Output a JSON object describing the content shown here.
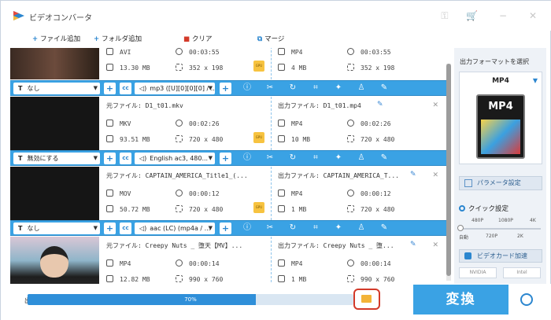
{
  "app": {
    "title": "ビデオコンバータ"
  },
  "toolbar": {
    "add_file": "ファイル追加",
    "add_folder": "フォルダ追加",
    "clear": "クリア",
    "merge": "マージ"
  },
  "rows": [
    {
      "source_name": "",
      "output_name": "",
      "src": {
        "format": "AVI",
        "duration": "00:03:55",
        "size": "13.30 MB",
        "resolution": "352 x 198"
      },
      "out": {
        "format": "MP4",
        "duration": "00:03:55",
        "size": "4 MB",
        "resolution": "352 x 198"
      },
      "subtitle": "なし",
      "audio": "mp3 ([U][0][0][0] / ..."
    },
    {
      "source_name": "元ファイル: D1_t01.mkv",
      "output_name": "出力ファイル: D1_t01.mp4",
      "src": {
        "format": "MKV",
        "duration": "00:02:26",
        "size": "93.51 MB",
        "resolution": "720 x 480"
      },
      "out": {
        "format": "MP4",
        "duration": "00:02:26",
        "size": "10 MB",
        "resolution": "720 x 480"
      },
      "subtitle": "無効にする",
      "audio": "English ac3, 480..."
    },
    {
      "source_name": "元ファイル: CAPTAIN_AMERICA_Title1_(...",
      "output_name": "出力ファイル: CAPTAIN_AMERICA_T...",
      "src": {
        "format": "MOV",
        "duration": "00:00:12",
        "size": "50.72 MB",
        "resolution": "720 x 480"
      },
      "out": {
        "format": "MP4",
        "duration": "00:00:12",
        "size": "1 MB",
        "resolution": "720 x 480"
      },
      "subtitle": "なし",
      "audio": "aac (LC) (mp4a / ..."
    },
    {
      "source_name": "元ファイル: Creepy Nuts _ 堕天【MV】...",
      "output_name": "出力ファイル: Creepy Nuts _ 堕...",
      "src": {
        "format": "MP4",
        "duration": "00:00:14",
        "size": "12.82 MB",
        "resolution": "990 x 760"
      },
      "out": {
        "format": "MP4",
        "duration": "00:00:14",
        "size": "1 MB",
        "resolution": "990 x 760"
      }
    }
  ],
  "panel": {
    "title": "出力フォーマットを選択",
    "format": "MP4",
    "format_icon_text": "MP4",
    "param_label": "パラメータ設定",
    "quick_label": "クイック設定",
    "slider_top": [
      "480P",
      "1080P",
      "4K"
    ],
    "slider_bottom": [
      "自動",
      "720P",
      "2K"
    ],
    "gpu_accel_label": "ビデオカード加速",
    "vendor_nvidia": "NVIDIA",
    "vendor_intel": "Intel"
  },
  "bottom": {
    "output_label": "出",
    "progress": 70,
    "progress_text": "70%",
    "convert_label": "変換"
  },
  "colors": {
    "accent": "#3aa2e4",
    "highlight": "#d33a2a"
  }
}
